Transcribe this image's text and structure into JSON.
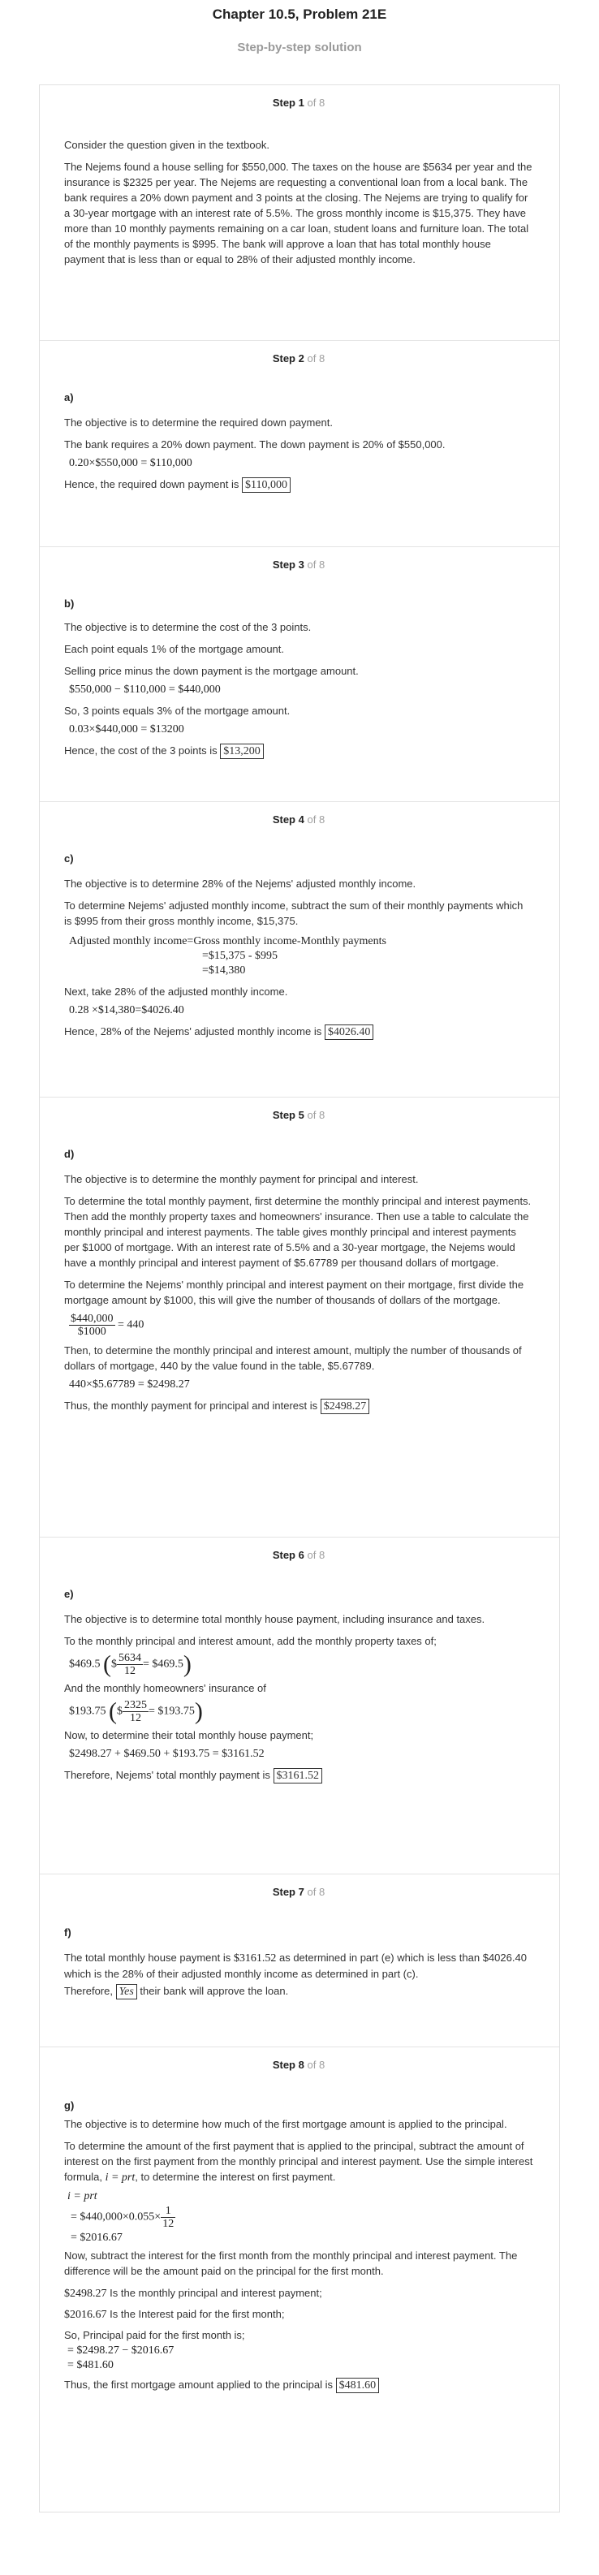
{
  "header": {
    "title": "Chapter 10.5, Problem 21E",
    "subtitle": "Step-by-step solution"
  },
  "step_word": "Step",
  "step_of": "of 8",
  "steps": [
    {
      "num": "1",
      "p1": "Consider the question given in the textbook.",
      "p2": "The Nejems found a house selling for $550,000. The taxes on the house are $5634 per year and the insurance is $2325 per year. The Nejems are requesting a conventional loan from a local bank. The bank requires a 20% down payment and 3 points at the closing. The Nejems are trying to qualify for a 30-year mortgage with an interest rate of 5.5%. The gross monthly income is $15,375. They have more than 10 monthly payments remaining on a car loan, student loans and furniture loan. The total of the monthly payments is $995. The bank will approve a loan that has total monthly house payment that is less than or equal to 28% of their adjusted monthly income."
    },
    {
      "num": "2",
      "part": "a)",
      "p1": "The objective is to determine the required down payment.",
      "p2": "The bank requires a 20% down payment. The down payment is 20% of $550,000.",
      "eq1": "0.20×$550,000 = $110,000",
      "p3": "Hence, the required down payment is",
      "ans": "$110,000"
    },
    {
      "num": "3",
      "part": "b)",
      "p1": "The objective is to determine the cost of the 3 points.",
      "p2": "Each point equals 1% of the mortgage amount.",
      "p3": "Selling price minus the down payment is the mortgage amount.",
      "eq1": "$550,000 − $110,000 = $440,000",
      "p4": "So, 3 points equals 3% of the mortgage amount.",
      "eq2": "0.03×$440,000 = $13200",
      "p5": "Hence, the cost of the 3 points is",
      "ans": "$13,200"
    },
    {
      "num": "4",
      "part": "c)",
      "p1": "The objective is to determine 28% of the Nejems' adjusted monthly income.",
      "p2": "To determine Nejems' adjusted monthly income, subtract the sum of their monthly payments which is $995 from their gross monthly income, $15,375.",
      "eq1": "Adjusted monthly income=Gross monthly income-Monthly payments",
      "eq2": "=$15,375 - $995",
      "eq3": "=$14,380",
      "p3": "Next, take 28% of the adjusted monthly income.",
      "eq4": "0.28 ×$14,380=$4026.40",
      "p4a": "Hence,",
      "p4b": "28%",
      "p4c": "of the Nejems' adjusted monthly income is",
      "ans": "$4026.40"
    },
    {
      "num": "5",
      "part": "d)",
      "p1": "The objective is to determine the monthly payment for principal and interest.",
      "p2": "To determine the total monthly payment, first determine the monthly principal and interest payments. Then add the monthly property taxes and homeowners' insurance. Then use a table to calculate the monthly principal and interest payments. The table gives monthly principal and interest payments per $1000 of mortgage. With an interest rate of 5.5% and a 30-year mortgage, the Nejems would have a monthly principal and interest payment of $5.67789 per thousand dollars of mortgage.",
      "p3": "To determine the Nejems' monthly principal and interest payment on their mortgage, first divide the mortgage amount by $1000, this will give the number of thousands of dollars of the mortgage.",
      "frac_n": "$440,000",
      "frac_d": "$1000",
      "frac_r": "= 440",
      "p4": "Then, to determine the monthly principal and interest amount, multiply the number of thousands of dollars of mortgage, 440 by the value found in the table, $5.67789.",
      "eq1": "440×$5.67789 = $2498.27",
      "p5": "Thus, the monthly payment for principal and interest is",
      "ans": "$2498.27"
    },
    {
      "num": "6",
      "part": "e)",
      "p1": "The objective is to determine total monthly house payment, including insurance and taxes.",
      "p2": "To the monthly principal and interest amount, add the monthly property taxes of;",
      "eq1_pre": "$469.5",
      "eq1_s": "$",
      "eq1_n": "5634",
      "eq1_d": "12",
      "eq1_r": "= $469.5",
      "p3": "And the monthly homeowners' insurance of",
      "eq2_pre": "$193.75",
      "eq2_s": "$",
      "eq2_n": "2325",
      "eq2_d": "12",
      "eq2_r": "= $193.75",
      "p4": "Now, to determine their total monthly house payment;",
      "eq3": "$2498.27 + $469.50 + $193.75 = $3161.52",
      "p5": "Therefore, Nejems' total monthly payment is",
      "ans": "$3161.52"
    },
    {
      "num": "7",
      "part": "f)",
      "p1a": "The total monthly house payment is",
      "p1b": "$3161.52",
      "p1c": "as determined in part (e) which is less than $4026.40 which is the 28% of their adjusted monthly income as determined in part (c).",
      "p2a": "Therefore,",
      "ans": "Yes",
      "p2b": "their bank will approve the loan."
    },
    {
      "num": "8",
      "part": "g)",
      "p1": "The objective is to determine how much of the first mortgage amount is applied to the principal.",
      "p2a": "To determine the amount of the first payment that is applied to the principal, subtract the amount of interest on the first payment from the monthly principal and interest payment. Use the simple interest formula,",
      "p2b": "i = prt",
      "p2c": ", to determine the interest on first payment.",
      "eq1": "i = prt",
      "eq2": "= $440,000×0.055×",
      "eq2_n": "1",
      "eq2_d": "12",
      "eq3": "= $2016.67",
      "p3": "Now, subtract the interest for the first month from the monthly principal and interest payment. The difference will be the amount paid on the principal for the first month.",
      "p4a": "$2498.27",
      "p4b": "Is the monthly principal and interest payment;",
      "p5a": "$2016.67",
      "p5b": "Is the Interest paid for the first month;",
      "p6": "So, Principal paid for the first month is;",
      "eq4": "= $2498.27 − $2016.67",
      "eq5": "= $481.60",
      "p7": "Thus, the first mortgage amount applied to the principal is",
      "ans": "$481.60"
    }
  ]
}
